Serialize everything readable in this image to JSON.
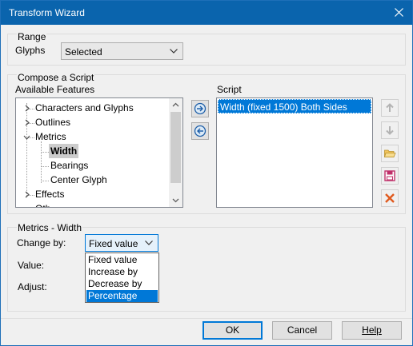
{
  "window": {
    "title": "Transform Wizard"
  },
  "range": {
    "group_label": "Range",
    "glyphs_label": "Glyphs",
    "glyphs_value": "Selected"
  },
  "compose": {
    "group_label": "Compose a Script",
    "available_label": "Available Features",
    "script_label": "Script",
    "tree": [
      {
        "label": "Characters and Glyphs"
      },
      {
        "label": "Outlines"
      },
      {
        "label": "Metrics"
      },
      {
        "label": "Width"
      },
      {
        "label": "Bearings"
      },
      {
        "label": "Center Glyph"
      },
      {
        "label": "Effects"
      },
      {
        "label": "Oth"
      }
    ],
    "script_items": [
      "Width (fixed 1500) Both Sides"
    ]
  },
  "metrics": {
    "group_label": "Metrics - Width",
    "change_by_label": "Change by:",
    "change_by_value": "Fixed value",
    "value_label": "Value:",
    "adjust_label": "Adjust:",
    "options": [
      "Fixed value",
      "Increase by",
      "Decrease by",
      "Percentage"
    ],
    "highlighted_option": "Percentage"
  },
  "buttons": {
    "ok": "OK",
    "cancel": "Cancel",
    "help": "Help"
  },
  "colors": {
    "title_bar": "#0a64ad",
    "selection": "#0078d7",
    "delete": "#e05a1e"
  }
}
